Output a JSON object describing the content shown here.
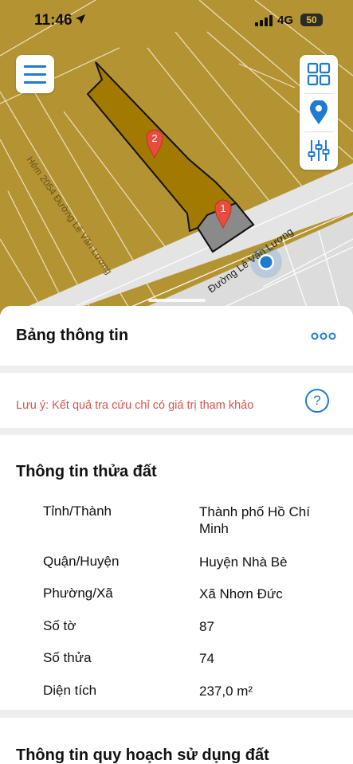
{
  "status_bar": {
    "time": "11:46",
    "network": "4G",
    "battery": "50"
  },
  "map": {
    "street_main": "Đường Lê Văn Lương",
    "street_alley": "Hẻm 2054 Đường Lê Văn Lương",
    "marker_1": "1",
    "marker_2": "2",
    "colors": {
      "land": "#b49432",
      "parcel_selected": "#a37a00",
      "parcel_highlight": "#8a8a8a",
      "road": "#e4e4e4",
      "marker": "#e84c3d",
      "accent": "#1f7ad1"
    }
  },
  "controls": {
    "menu_icon": "hamburger-icon",
    "grid_icon": "grid-icon",
    "location_icon": "location-pin-icon",
    "filter_icon": "sliders-icon"
  },
  "info_panel": {
    "title": "Bảng thông tin",
    "more_icon": "more-dots-icon",
    "note": "Lưu ý: Kết quả tra cứu chỉ có giá trị tham khảo",
    "help_label": "?"
  },
  "parcel_info": {
    "title": "Thông tin thửa đất",
    "rows": [
      {
        "label": "Tỉnh/Thành",
        "value": "Thành phố Hồ Chí Minh"
      },
      {
        "label": "Quận/Huyện",
        "value": "Huyện Nhà Bè"
      },
      {
        "label": "Phường/Xã",
        "value": "Xã Nhơn Đức"
      },
      {
        "label": "Số tờ",
        "value": "87"
      },
      {
        "label": "Số thửa",
        "value": "74"
      },
      {
        "label": "Diện tích",
        "value": "237,0 m²"
      }
    ]
  },
  "planning_info": {
    "title": "Thông tin quy hoạch sử dụng đất"
  }
}
